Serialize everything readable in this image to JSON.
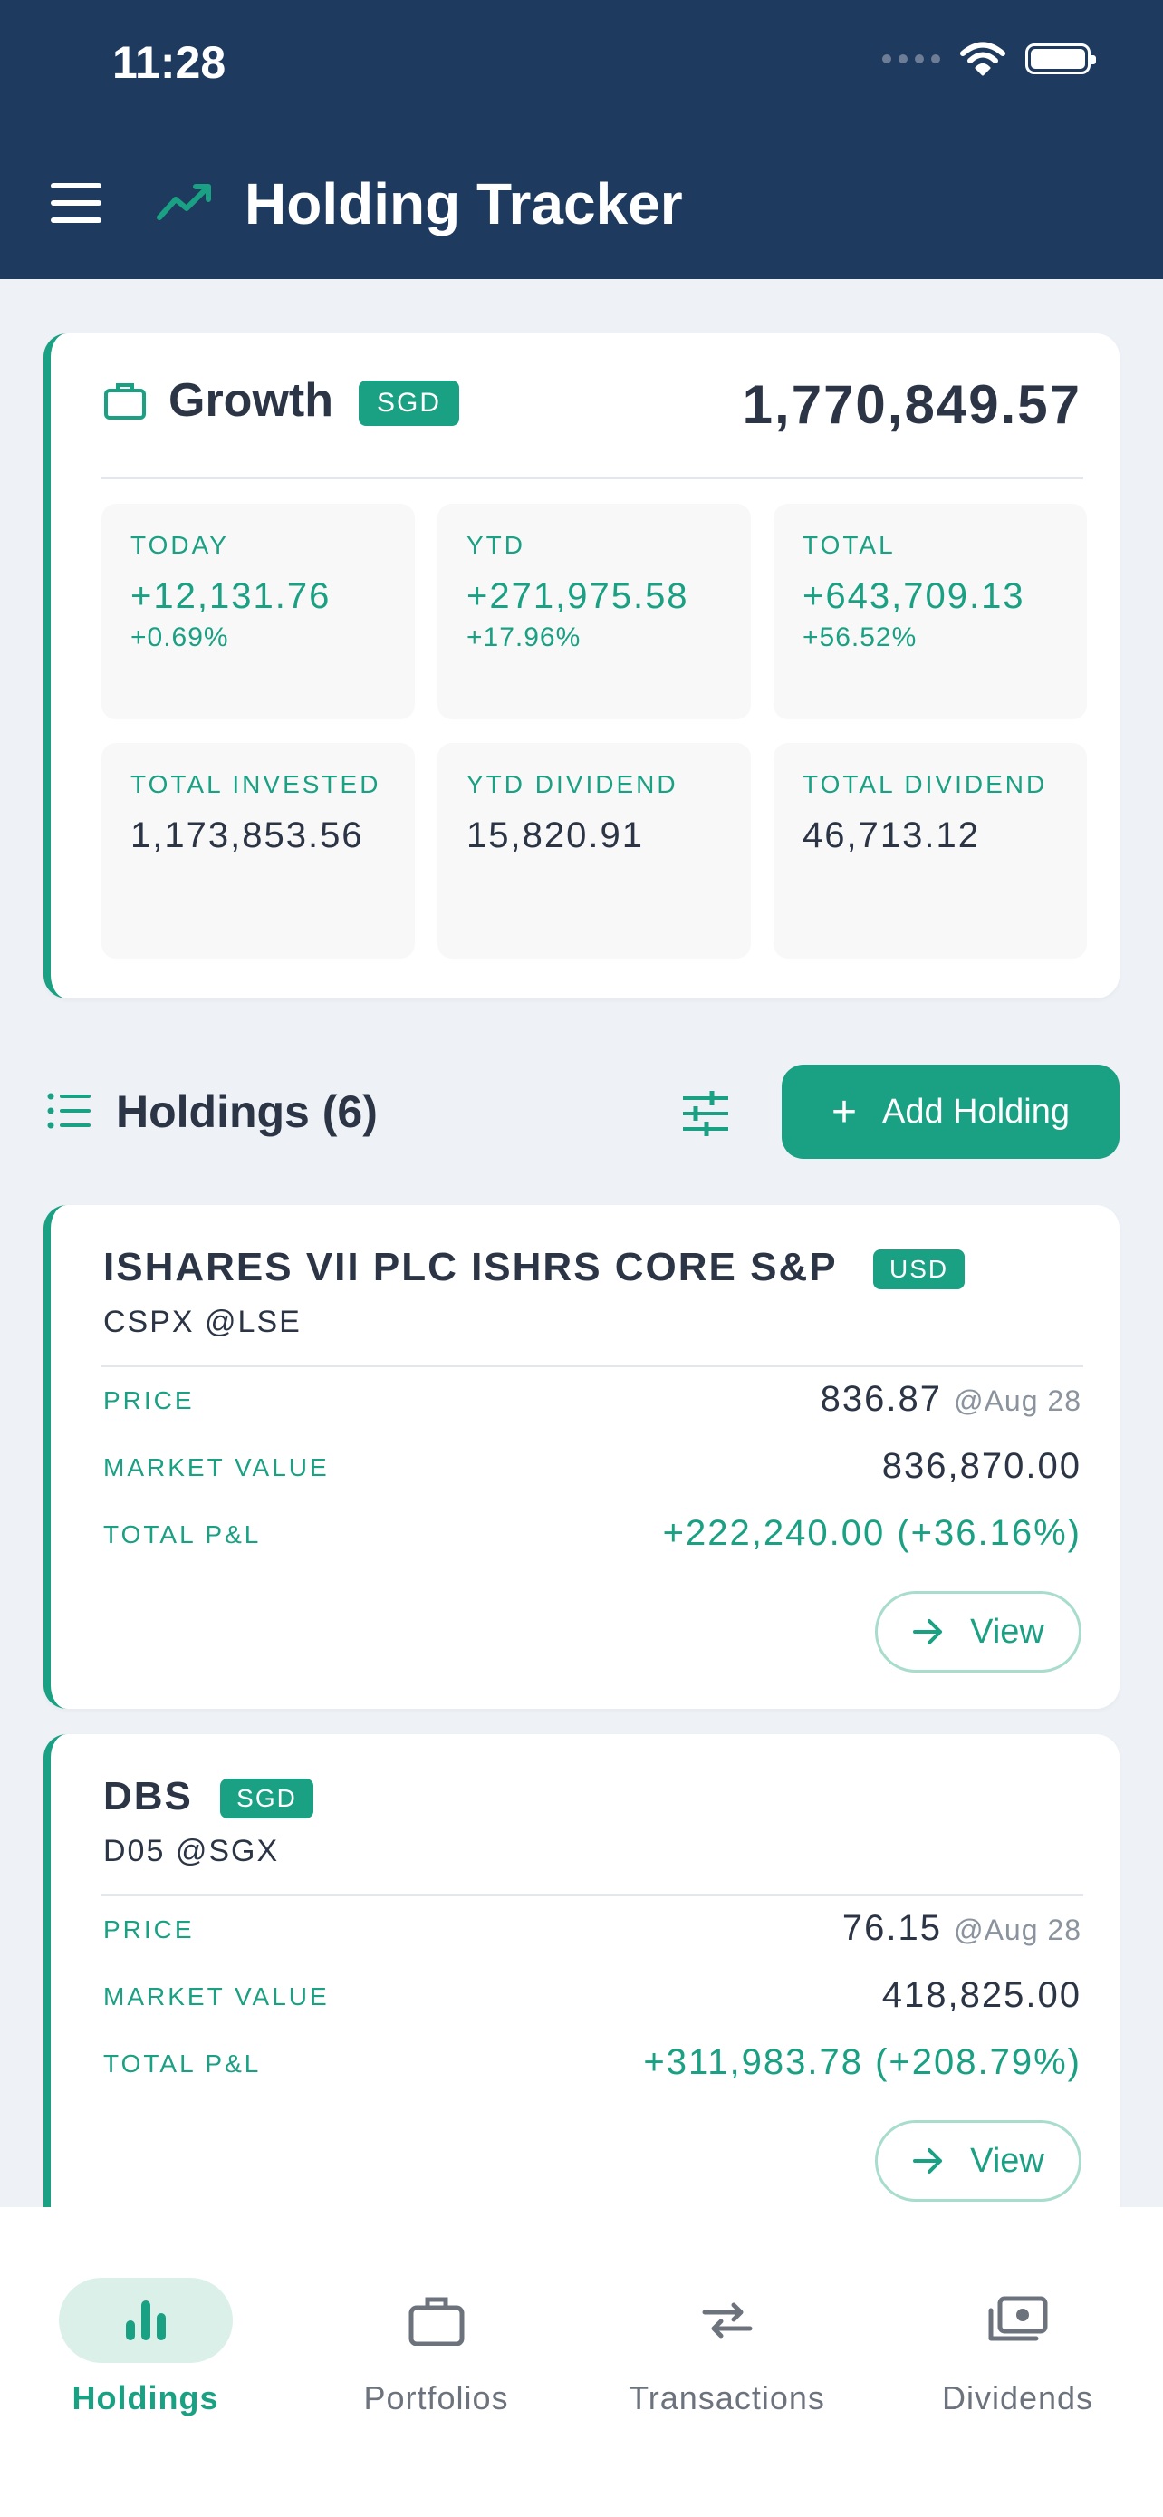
{
  "status_bar": {
    "time": "11:28"
  },
  "header": {
    "title": "Holding Tracker"
  },
  "portfolio": {
    "name": "Growth",
    "currency": "SGD",
    "total_value": "1,770,849.57",
    "stats": [
      {
        "label": "TODAY",
        "value": "+12,131.76",
        "pct": "+0.69%"
      },
      {
        "label": "YTD",
        "value": "+271,975.58",
        "pct": "+17.96%"
      },
      {
        "label": "TOTAL",
        "value": "+643,709.13",
        "pct": "+56.52%"
      },
      {
        "label": "TOTAL INVESTED",
        "value": "1,173,853.56",
        "pct": ""
      },
      {
        "label": "YTD DIVIDEND",
        "value": "15,820.91",
        "pct": ""
      },
      {
        "label": "TOTAL DIVIDEND",
        "value": "46,713.12",
        "pct": ""
      }
    ]
  },
  "holdings_section": {
    "title": "Holdings (6)",
    "add_label": "Add Holding"
  },
  "holdings": [
    {
      "name": "ISHARES VII PLC ISHRS CORE S&P",
      "currency": "USD",
      "ticker": "CSPX @LSE",
      "price_label": "PRICE",
      "price": "836.87",
      "price_date": "@Aug 28",
      "mv_label": "MARKET VALUE",
      "market_value": "836,870.00",
      "pl_label": "TOTAL P&L",
      "pl": "+222,240.00 (+36.16%)",
      "view_label": "View"
    },
    {
      "name": "DBS",
      "currency": "SGD",
      "ticker": "D05 @SGX",
      "price_label": "PRICE",
      "price": "76.15",
      "price_date": "@Aug 28",
      "mv_label": "MARKET VALUE",
      "market_value": "418,825.00",
      "pl_label": "TOTAL P&L",
      "pl": "+311,983.78 (+208.79%)",
      "view_label": "View"
    }
  ],
  "bottom_nav": [
    {
      "label": "Holdings",
      "icon": "bar-chart-icon",
      "active": true
    },
    {
      "label": "Portfolios",
      "icon": "briefcase-icon",
      "active": false
    },
    {
      "label": "Transactions",
      "icon": "swap-arrows-icon",
      "active": false
    },
    {
      "label": "Dividends",
      "icon": "cash-stack-icon",
      "active": false
    }
  ],
  "colors": {
    "accent": "#1aa083",
    "header_bg": "#1f3a5f",
    "page_bg": "#eef2f6"
  }
}
